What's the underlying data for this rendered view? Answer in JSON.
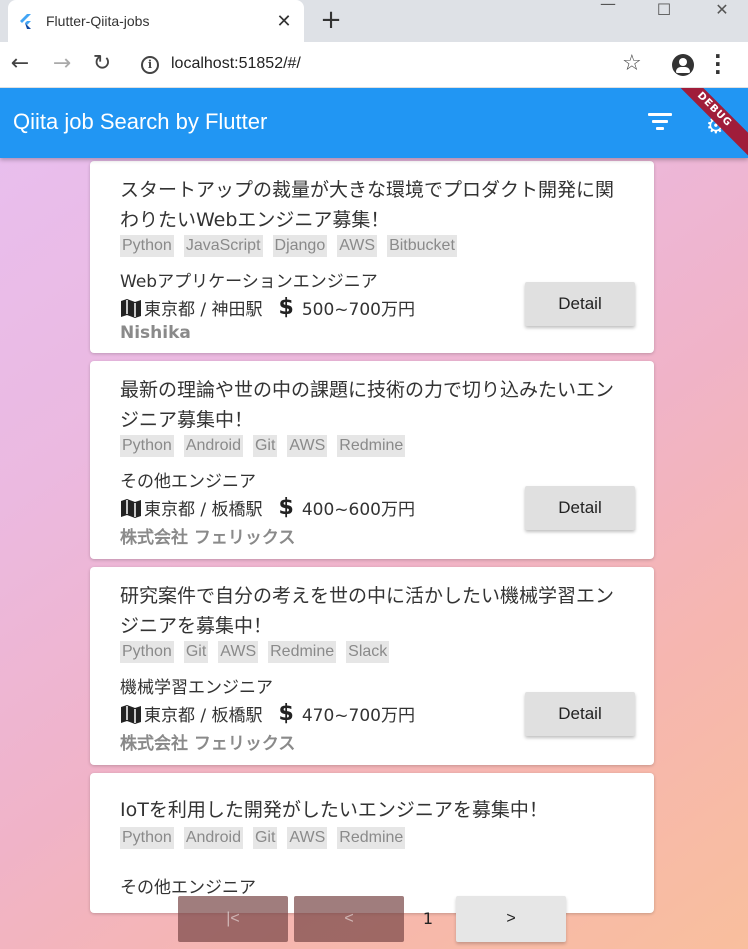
{
  "browser": {
    "tab_title": "Flutter-Qiita-jobs",
    "tab_close": "✕",
    "new_tab": "+",
    "url": "localhost:51852/#/",
    "window_controls": {
      "minimize": "—",
      "maximize": "☐",
      "close": "✕"
    }
  },
  "appbar": {
    "title": "Qiita job Search by Flutter",
    "debug_label": "DEBUG"
  },
  "jobs": [
    {
      "title": "スタートアップの裁量が大きな環境でプロダクト開発に関わりたいWebエンジニア募集！",
      "tags": [
        "Python",
        "JavaScript",
        "Django",
        "AWS",
        "Bitbucket"
      ],
      "position": "Webアプリケーションエンジニア",
      "location": "東京都 / 神田駅",
      "salary": "500~700万円",
      "company": "Nishika",
      "detail_label": "Detail"
    },
    {
      "title": "最新の理論や世の中の課題に技術の力で切り込みたいエンジニア募集中！",
      "tags": [
        "Python",
        "Android",
        "Git",
        "AWS",
        "Redmine"
      ],
      "position": "その他エンジニア",
      "location": "東京都 / 板橋駅",
      "salary": "400~600万円",
      "company": "株式会社 フェリックス",
      "detail_label": "Detail"
    },
    {
      "title": "研究案件で自分の考えを世の中に活かしたい機械学習エンジニアを募集中！",
      "tags": [
        "Python",
        "Git",
        "AWS",
        "Redmine",
        "Slack"
      ],
      "position": "機械学習エンジニア",
      "location": "東京都 / 板橋駅",
      "salary": "470~700万円",
      "company": "株式会社 フェリックス",
      "detail_label": "Detail"
    },
    {
      "title": "IoTを利用した開発がしたいエンジニアを募集中！",
      "tags": [
        "Python",
        "Android",
        "Git",
        "AWS",
        "Redmine"
      ],
      "position": "その他エンジニア"
    }
  ],
  "pager": {
    "first_label": "|<",
    "prev_label": "<",
    "page": "1",
    "next_label": ">"
  }
}
